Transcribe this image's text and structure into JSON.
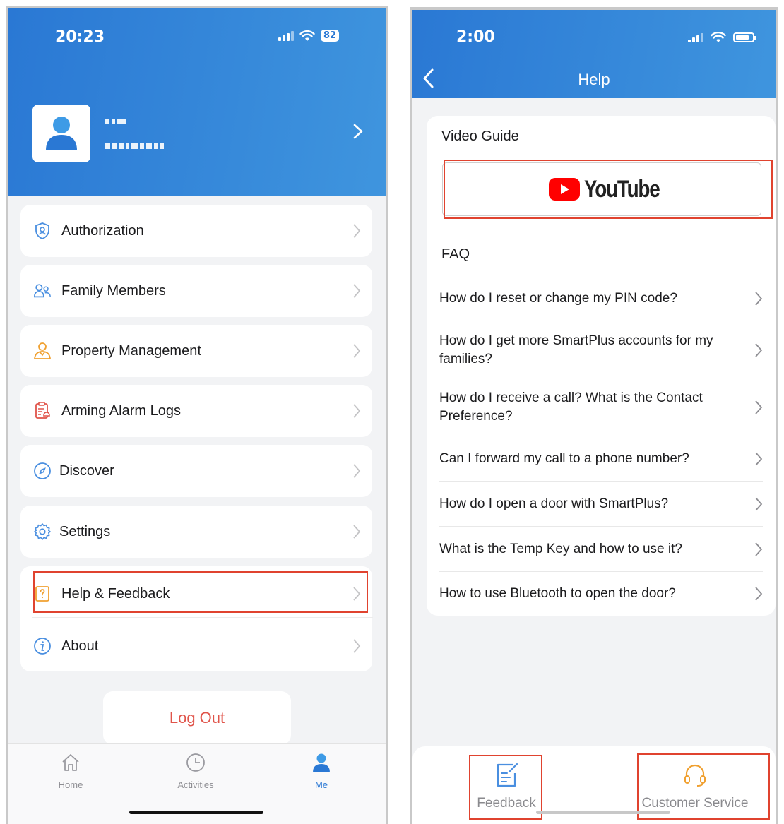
{
  "left": {
    "status": {
      "time": "20:23",
      "battery": "82"
    },
    "profile": {
      "name": "",
      "id": ""
    },
    "menu": [
      {
        "label": "Authorization",
        "icon": "shield-user-icon"
      },
      {
        "label": "Family Members",
        "icon": "users-icon"
      },
      {
        "label": "Property Management",
        "icon": "property-manager-icon"
      },
      {
        "label": "Arming Alarm Logs",
        "icon": "alarm-log-icon"
      },
      {
        "label": "Discover",
        "icon": "compass-icon"
      },
      {
        "label": "Settings",
        "icon": "gear-icon"
      },
      {
        "label": "Help & Feedback",
        "icon": "help-icon"
      },
      {
        "label": "About",
        "icon": "info-icon"
      }
    ],
    "logout": "Log Out",
    "tabs": [
      {
        "label": "Home",
        "icon": "home-icon"
      },
      {
        "label": "Activities",
        "icon": "clock-icon"
      },
      {
        "label": "Me",
        "icon": "person-icon",
        "active": true
      }
    ]
  },
  "right": {
    "status": {
      "time": "2:00"
    },
    "title": "Help",
    "video_guide": "Video Guide",
    "youtube": "YouTube",
    "faq_title": "FAQ",
    "faqs": [
      "How do I reset or change my PIN code?",
      "How do I get more SmartPlus accounts for my families?",
      "How do I receive a call? What is the Contact Preference?",
      "Can I forward my call to a phone number?",
      "How do I open a door with SmartPlus?",
      "What is the Temp Key and how to use it?",
      "How to use Bluetooth to open the door?"
    ],
    "bottom": {
      "feedback": "Feedback",
      "customer_service": "Customer Service"
    }
  },
  "colors": {
    "header_blue": "#2a78d4",
    "accent_blue": "#4a8fe0",
    "logout_red": "#e0544a",
    "highlight_red": "#e0432f",
    "icon_orange": "#f0a030"
  }
}
